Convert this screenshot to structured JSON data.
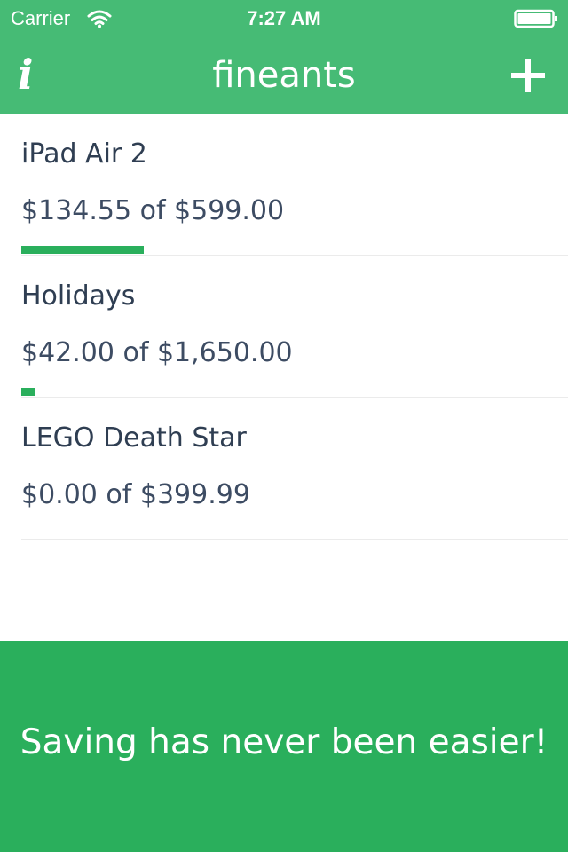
{
  "status_bar": {
    "carrier": "Carrier",
    "time": "7:27 AM",
    "wifi_icon": "wifi-icon",
    "battery_icon": "battery-icon"
  },
  "nav": {
    "title": "fineants",
    "info_icon": "i",
    "add_icon": "plus-icon"
  },
  "colors": {
    "header": "#46bb75",
    "accent": "#2aaf5c",
    "text_dark": "#2f3e52"
  },
  "goals": [
    {
      "name": "iPad Air 2",
      "amount": "$134.55 of $599.00",
      "progress": 0.2246
    },
    {
      "name": "Holidays",
      "amount": "$42.00 of $1,650.00",
      "progress": 0.0255
    },
    {
      "name": "LEGO Death Star",
      "amount": "$0.00 of $399.99",
      "progress": 0.0
    }
  ],
  "banner": {
    "text": "Saving has never been easier!"
  }
}
